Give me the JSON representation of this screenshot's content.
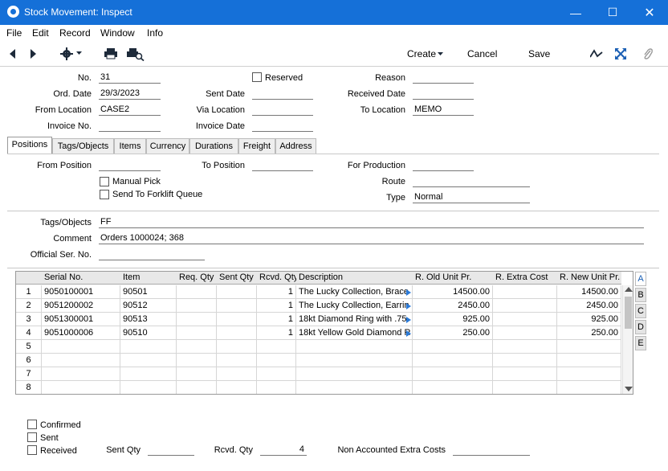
{
  "window": {
    "title": "Stock Movement: Inspect"
  },
  "menu": [
    "File",
    "Edit",
    "Record",
    "Window",
    "Info"
  ],
  "toolbar": {
    "create": "Create",
    "cancel": "Cancel",
    "save": "Save"
  },
  "header": {
    "no_label": "No.",
    "no": "31",
    "reserved_label": "Reserved",
    "reason_label": "Reason",
    "reason": "",
    "ord_date_label": "Ord. Date",
    "ord_date": "29/3/2023",
    "sent_date_label": "Sent Date",
    "sent_date": "",
    "received_date_label": "Received Date",
    "received_date": "",
    "from_location_label": "From Location",
    "from_location": "CASE2",
    "via_location_label": "Via Location",
    "via_location": "",
    "to_location_label": "To Location",
    "to_location": "MEMO",
    "invoice_no_label": "Invoice No.",
    "invoice_no": "",
    "invoice_date_label": "Invoice Date",
    "invoice_date": ""
  },
  "tabs": [
    "Positions",
    "Tags/Objects",
    "Items",
    "Currency",
    "Durations",
    "Freight",
    "Address"
  ],
  "positions": {
    "from_position_label": "From Position",
    "from_position": "",
    "to_position_label": "To Position",
    "to_position": "",
    "for_production_label": "For Production",
    "for_production": "",
    "manual_pick_label": "Manual Pick",
    "send_forklift_label": "Send To Forklift Queue",
    "route_label": "Route",
    "route": "",
    "type_label": "Type",
    "type": "Normal"
  },
  "misc": {
    "tags_label": "Tags/Objects",
    "tags": "FF",
    "comment_label": "Comment",
    "comment": "Orders 1000024; 368",
    "official_label": "Official Ser. No.",
    "official": ""
  },
  "grid": {
    "columns": [
      "Serial No.",
      "Item",
      "Req. Qty",
      "Sent Qty",
      "Rcvd. Qty",
      "Description",
      "R. Old Unit Pr.",
      "R. Extra Cost",
      "R. New Unit Pr."
    ],
    "rows": [
      {
        "n": "1",
        "serial": "9050100001",
        "item": "90501",
        "req": "",
        "sent": "",
        "rcvd": "1",
        "desc": "The Lucky Collection, Brace",
        "old": "14500.00",
        "extra": "",
        "new": "14500.00"
      },
      {
        "n": "2",
        "serial": "9051200002",
        "item": "90512",
        "req": "",
        "sent": "",
        "rcvd": "1",
        "desc": "The Lucky Collection, Earrin",
        "old": "2450.00",
        "extra": "",
        "new": "2450.00"
      },
      {
        "n": "3",
        "serial": "9051300001",
        "item": "90513",
        "req": "",
        "sent": "",
        "rcvd": "1",
        "desc": "18kt Diamond Ring with .75",
        "old": "925.00",
        "extra": "",
        "new": "925.00"
      },
      {
        "n": "4",
        "serial": "9051000006",
        "item": "90510",
        "req": "",
        "sent": "",
        "rcvd": "1",
        "desc": "18kt Yellow Gold Diamond R",
        "old": "250.00",
        "extra": "",
        "new": "250.00"
      },
      {
        "n": "5",
        "serial": "",
        "item": "",
        "req": "",
        "sent": "",
        "rcvd": "",
        "desc": "",
        "old": "",
        "extra": "",
        "new": ""
      },
      {
        "n": "6",
        "serial": "",
        "item": "",
        "req": "",
        "sent": "",
        "rcvd": "",
        "desc": "",
        "old": "",
        "extra": "",
        "new": ""
      },
      {
        "n": "7",
        "serial": "",
        "item": "",
        "req": "",
        "sent": "",
        "rcvd": "",
        "desc": "",
        "old": "",
        "extra": "",
        "new": ""
      },
      {
        "n": "8",
        "serial": "",
        "item": "",
        "req": "",
        "sent": "",
        "rcvd": "",
        "desc": "",
        "old": "",
        "extra": "",
        "new": ""
      }
    ],
    "side_tabs": [
      "A",
      "B",
      "C",
      "D",
      "E"
    ]
  },
  "footer": {
    "confirmed_label": "Confirmed",
    "sent_label": "Sent",
    "received_label": "Received",
    "sent_qty_label": "Sent Qty",
    "sent_qty": "",
    "rcvd_qty_label": "Rcvd. Qty",
    "rcvd_qty": "4",
    "non_acc_label": "Non Accounted Extra Costs",
    "non_acc": ""
  },
  "colors": {
    "titlebar": "#1570d8",
    "accent": "#1a5fb4"
  }
}
